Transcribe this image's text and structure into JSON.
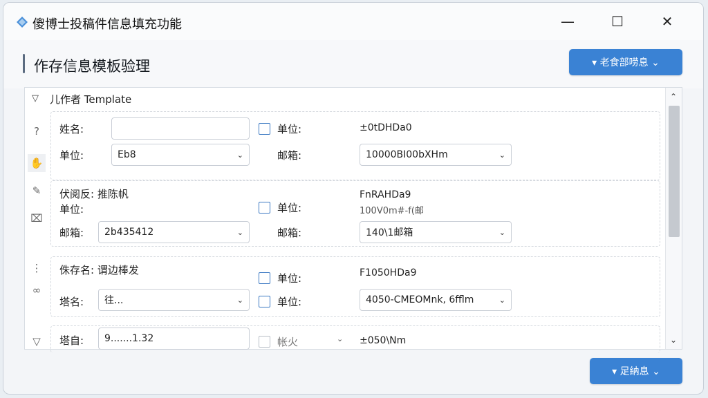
{
  "window": {
    "app_title": "傻博士投稿件信息填充功能",
    "minimize_glyph": "—",
    "maximize_glyph": "☐",
    "close_glyph": "✕"
  },
  "header": {
    "page_title": "作存信息模板验理",
    "top_button_label": "▾ 老食部唠息 ⌄"
  },
  "panel": {
    "header_chevron": "▽",
    "header_label": "儿作者 Template",
    "rail_icons": [
      "question-icon",
      "hand-icon",
      "pen-icon",
      "badge-icon",
      "more-icon",
      "link-icon",
      "collapse-icon"
    ],
    "sections": [
      {
        "rows": [
          {
            "label": "姓名:",
            "input_value": "",
            "right_label": "单位:",
            "right_value": "±0tDHDa0",
            "checkbox": false
          },
          {
            "label": "单位:",
            "select_value": "Eb8",
            "right_label": "邮箱:",
            "right_select_value": "10000BI00bXHm"
          }
        ]
      },
      {
        "rows": [
          {
            "label": "伏阅反: 推陈帆",
            "right_label": "单位:",
            "right_value_1": "FnRAHDa9",
            "right_value_2": "100V0m#-f(邮"
          },
          {
            "label": "单位:"
          },
          {
            "label": "邮箱:",
            "select_value": "2b435412",
            "right_label": "邮箱:",
            "right_select_value": "140\\1邮箱"
          }
        ]
      },
      {
        "rows": [
          {
            "label": "侏存名: 谓边棒发",
            "right_label": "单位:",
            "right_value": "F1050HDa9"
          },
          {
            "label": "塔名:",
            "select_value": "往...",
            "right_label": "单位:",
            "right_select_value": "4050-CMEOMnk, 6fflm"
          }
        ]
      },
      {
        "rows": [
          {
            "label": "塔自:",
            "input_value": "9.......1.32",
            "right_label": "帐火",
            "right_value": "±050\\Nm"
          }
        ]
      }
    ]
  },
  "footer": {
    "bottom_button_label": "▾ 足納息 ⌄"
  }
}
